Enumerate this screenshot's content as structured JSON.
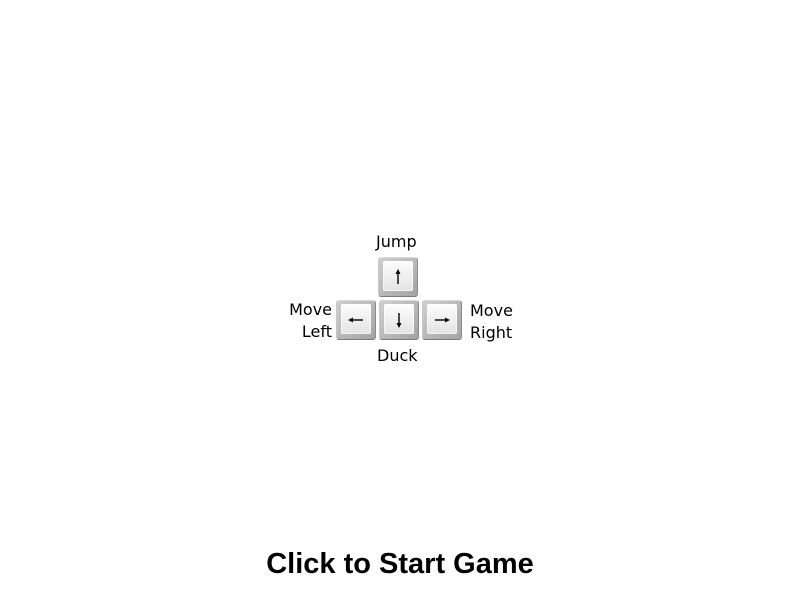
{
  "controls": {
    "jump_label": "Jump",
    "duck_label": "Duck",
    "move_left_line1": "Move",
    "move_left_line2": "Left",
    "move_right_line1": "Move",
    "move_right_line2": "Right"
  },
  "keys": {
    "up": "arrow-up-icon",
    "down": "arrow-down-icon",
    "left": "arrow-left-icon",
    "right": "arrow-right-icon"
  },
  "start_prompt": "Click to Start Game"
}
